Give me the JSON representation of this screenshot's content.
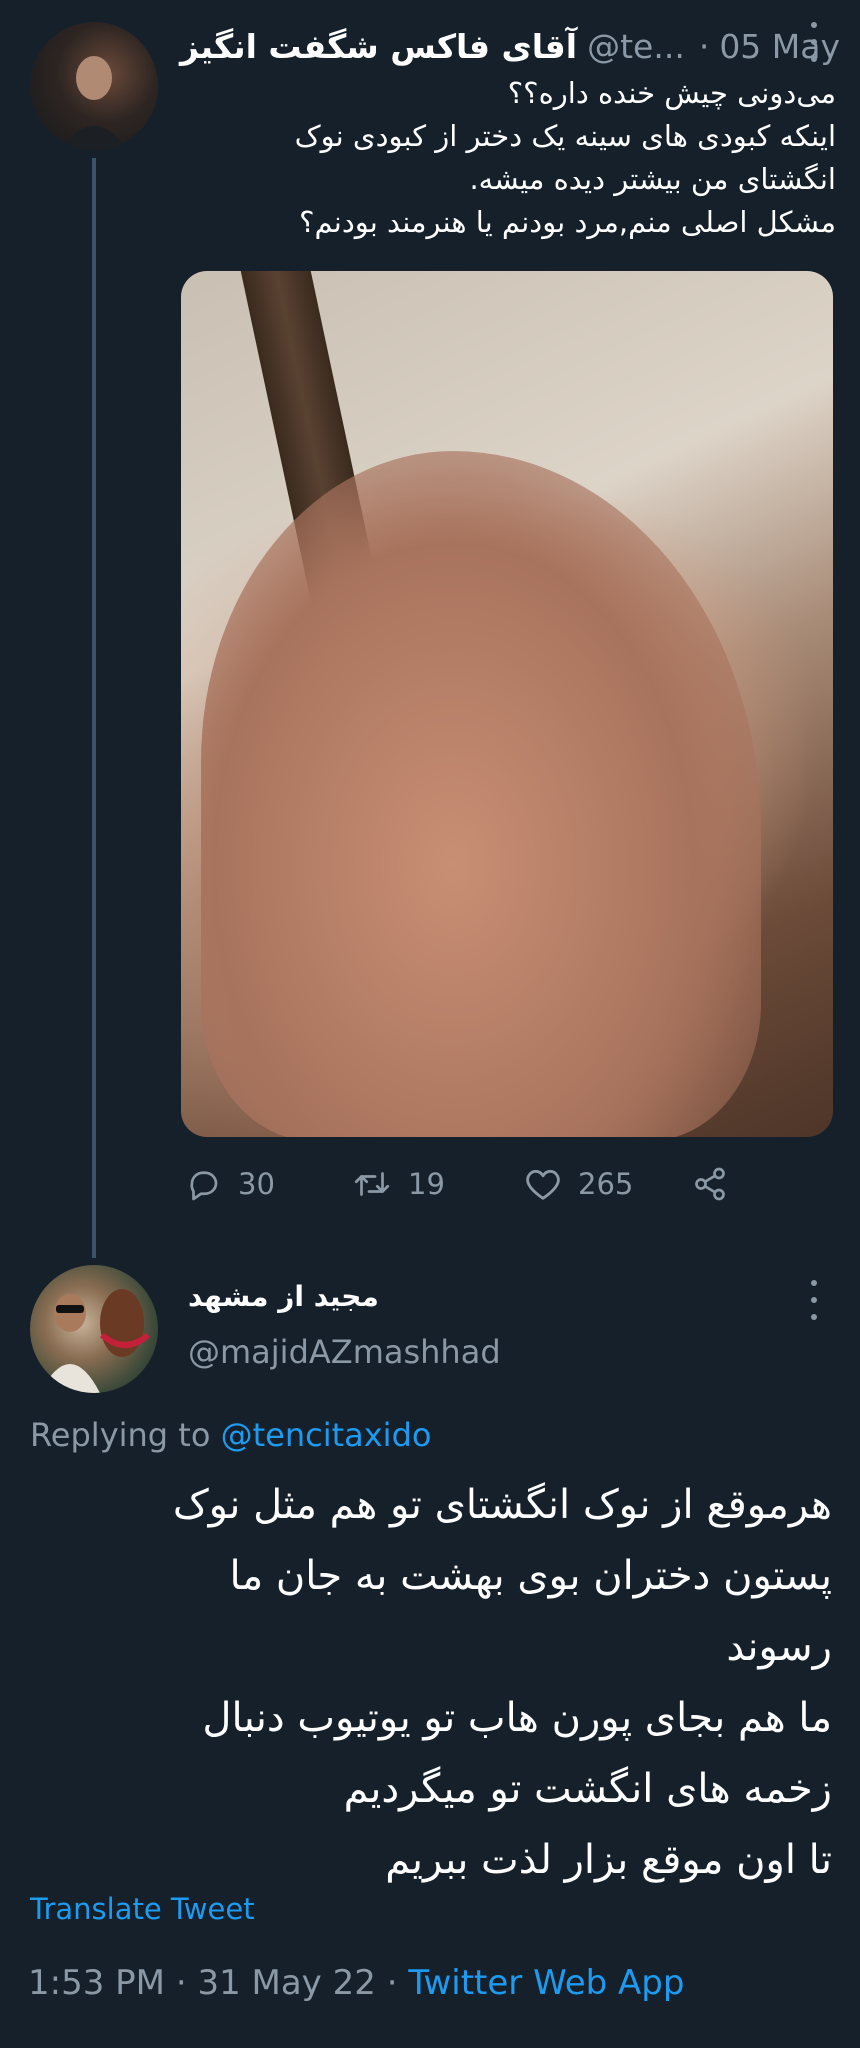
{
  "parent_tweet": {
    "author_name": "آقای فاکس شگفت انگیز",
    "handle": "@te...",
    "separator": "·",
    "date": "05 May",
    "text_lines": [
      "می‌دونی چیش خنده داره؟؟",
      "اینکه کبودی های سینه یک دختر از کبودی نوک",
      "انگشتای من بیشتر دیده میشه.",
      "مشکل اصلی منم,مرد بودنم یا هنرمند بودنم؟"
    ],
    "media_alt": "hand-photo",
    "actions": {
      "replies": "30",
      "retweets": "19",
      "likes": "265"
    }
  },
  "reply_tweet": {
    "author_name": "مجید از مشهد",
    "handle": "@majidAZmashhad",
    "replying_prefix": "Replying to",
    "replying_to": "@tencitaxido",
    "text_lines": [
      "هرموقع از نوک انگشتای تو هم مثل نوک",
      "پستون دختران بوی بهشت به جان ما",
      "رسوند",
      "ما هم بجای پورن هاب تو یوتیوب دنبال",
      "زخمه های انگشت تو میگردیم",
      "تا اون موقع بزار لذت ببریم"
    ],
    "translate_label": "Translate Tweet",
    "time": "1:53 PM",
    "dot": "·",
    "date": "31 May 22",
    "source": "Twitter Web App"
  },
  "colors": {
    "background": "#15202b",
    "text": "#ffffff",
    "muted": "#8b98a5",
    "link": "#1d9bf0"
  }
}
